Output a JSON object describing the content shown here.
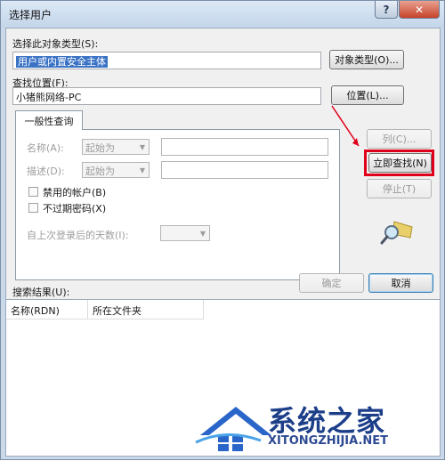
{
  "window": {
    "title": "选择用户",
    "help_glyph": "?",
    "close_glyph": "✕"
  },
  "object_type": {
    "label": "选择此对象类型(S):",
    "value": "用户或内置安全主体",
    "button": "对象类型(O)..."
  },
  "location": {
    "label": "查找位置(F):",
    "value": "小猪熊网络-PC",
    "button": "位置(L)..."
  },
  "query": {
    "tab_label": "一般性查询",
    "name_label": "名称(A):",
    "name_mode": "起始为",
    "desc_label": "描述(D):",
    "desc_mode": "起始为",
    "disabled_accounts": "禁用的帐户(B)",
    "non_expiring_pw": "不过期密码(X)",
    "days_since_login": "自上次登录后的天数(I):"
  },
  "side_buttons": {
    "columns": "列(C)...",
    "find_now": "立即查找(N)",
    "stop": "停止(T)"
  },
  "actions": {
    "ok": "确定",
    "cancel": "取消"
  },
  "results": {
    "label": "搜索结果(U):",
    "columns": [
      "名称(RDN)",
      "所在文件夹"
    ]
  },
  "watermark": {
    "title": "系统之家",
    "url": "XITONGZHIJIA.NET"
  },
  "colors": {
    "highlight": "#e1001a",
    "brand": "#1d3f8a"
  },
  "icons": {
    "search": "search-icon"
  }
}
